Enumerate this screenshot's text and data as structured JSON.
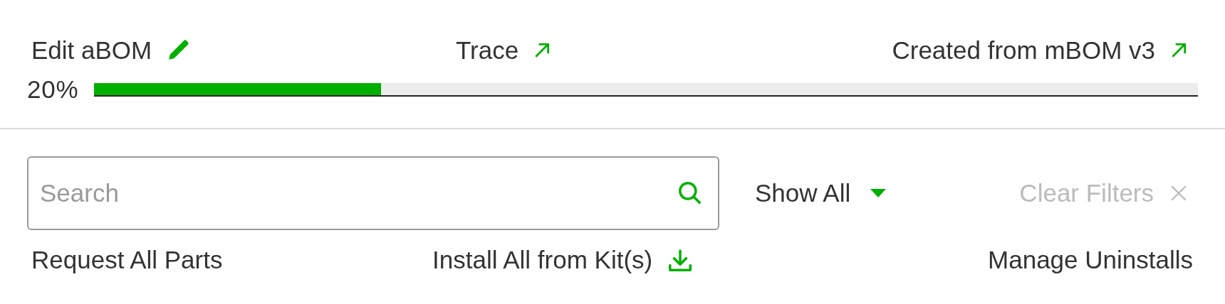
{
  "header_links": [
    {
      "label": "Edit aBOM",
      "kind": "edit"
    },
    {
      "label": "Trace",
      "kind": "external"
    },
    {
      "label": "Created from mBOM v3",
      "kind": "external"
    }
  ],
  "progress": {
    "reading": "20%",
    "level": 0.26
  },
  "search": {
    "placeholder": "Search"
  },
  "filter": {
    "label": "Show All"
  },
  "clear_filters": {
    "label": "Clear Filters",
    "disabled": true
  },
  "actions": [
    {
      "label": "Request All Parts",
      "kind": "plain"
    },
    {
      "label": "Install All from Kit(s)",
      "kind": "download"
    },
    {
      "label": "Manage Uninstalls",
      "kind": "plain"
    }
  ]
}
